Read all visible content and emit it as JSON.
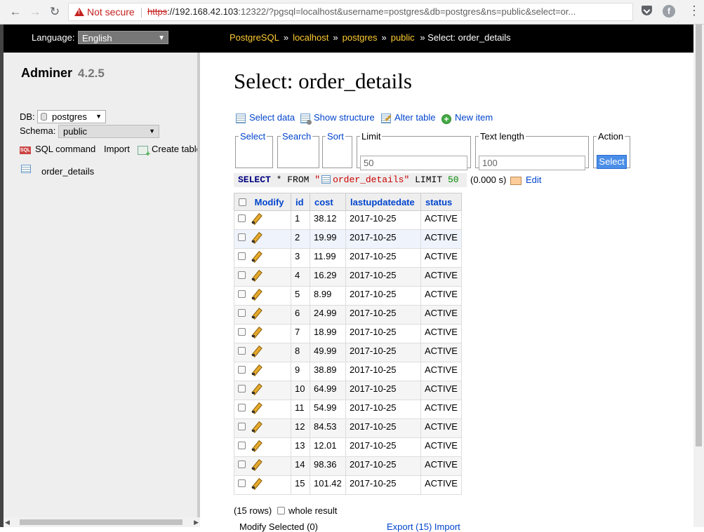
{
  "browser": {
    "back_icon": "arrow-left-icon",
    "forward_icon": "arrow-right-icon",
    "reload_icon": "reload-icon",
    "security_label": "Not secure",
    "url_scheme": "https",
    "url_host": "://192.168.42.103",
    "url_rest": ":12322/?pgsql=localhost&username=postgres&db=postgres&ns=public&select=or..."
  },
  "header": {
    "language_label": "Language:",
    "language_value": "English",
    "breadcrumb": {
      "system": "PostgreSQL",
      "server": "localhost",
      "database": "postgres",
      "schema": "public",
      "current": "» Select: order_details",
      "sep": "»"
    }
  },
  "sidebar": {
    "app_name": "Adminer",
    "version": "4.2.5",
    "db_label": "DB:",
    "db_value": "postgres",
    "schema_label": "Schema:",
    "schema_value": "public",
    "sql_icon_text": "SQL",
    "sql_command": "SQL command",
    "import": "Import",
    "create_table": "Create table",
    "tables": [
      "order_details"
    ]
  },
  "main": {
    "title": "Select: order_details",
    "actions": {
      "select_data": "Select data",
      "show_structure": "Show structure",
      "alter_table": "Alter table",
      "new_item": "New item",
      "new_item_symbol": "+"
    },
    "form": {
      "select_legend": "Select",
      "search_legend": "Search",
      "sort_legend": "Sort",
      "limit_legend": "Limit",
      "limit_value": "50",
      "text_length_legend": "Text length",
      "text_length_value": "100",
      "action_legend": "Action",
      "action_button": "Select"
    },
    "query": {
      "select_kw": "SELECT",
      "star_from": "* FROM",
      "quote_open": "\"",
      "table": "order_details",
      "quote_close": "\"",
      "limit_kw": "LIMIT",
      "limit_num": "50",
      "time": "(0.000 s)",
      "edit": "Edit"
    },
    "table": {
      "columns": [
        "Modify",
        "id",
        "cost",
        "lastupdatedate",
        "status"
      ],
      "rows": [
        {
          "id": "1",
          "cost": "38.12",
          "date": "2017-10-25",
          "status": "ACTIVE"
        },
        {
          "id": "2",
          "cost": "19.99",
          "date": "2017-10-25",
          "status": "ACTIVE"
        },
        {
          "id": "3",
          "cost": "11.99",
          "date": "2017-10-25",
          "status": "ACTIVE"
        },
        {
          "id": "4",
          "cost": "16.29",
          "date": "2017-10-25",
          "status": "ACTIVE"
        },
        {
          "id": "5",
          "cost": "8.99",
          "date": "2017-10-25",
          "status": "ACTIVE"
        },
        {
          "id": "6",
          "cost": "24.99",
          "date": "2017-10-25",
          "status": "ACTIVE"
        },
        {
          "id": "7",
          "cost": "18.99",
          "date": "2017-10-25",
          "status": "ACTIVE"
        },
        {
          "id": "8",
          "cost": "49.99",
          "date": "2017-10-25",
          "status": "ACTIVE"
        },
        {
          "id": "9",
          "cost": "38.89",
          "date": "2017-10-25",
          "status": "ACTIVE"
        },
        {
          "id": "10",
          "cost": "64.99",
          "date": "2017-10-25",
          "status": "ACTIVE"
        },
        {
          "id": "11",
          "cost": "54.99",
          "date": "2017-10-25",
          "status": "ACTIVE"
        },
        {
          "id": "12",
          "cost": "84.53",
          "date": "2017-10-25",
          "status": "ACTIVE"
        },
        {
          "id": "13",
          "cost": "12.01",
          "date": "2017-10-25",
          "status": "ACTIVE"
        },
        {
          "id": "14",
          "cost": "98.36",
          "date": "2017-10-25",
          "status": "ACTIVE"
        },
        {
          "id": "15",
          "cost": "101.42",
          "date": "2017-10-25",
          "status": "ACTIVE"
        }
      ]
    },
    "footer": {
      "row_count": "(15 rows)",
      "whole_result": "whole result",
      "modify_selected": "Modify    Selected (0)",
      "export": "Export (15)    Import"
    }
  }
}
